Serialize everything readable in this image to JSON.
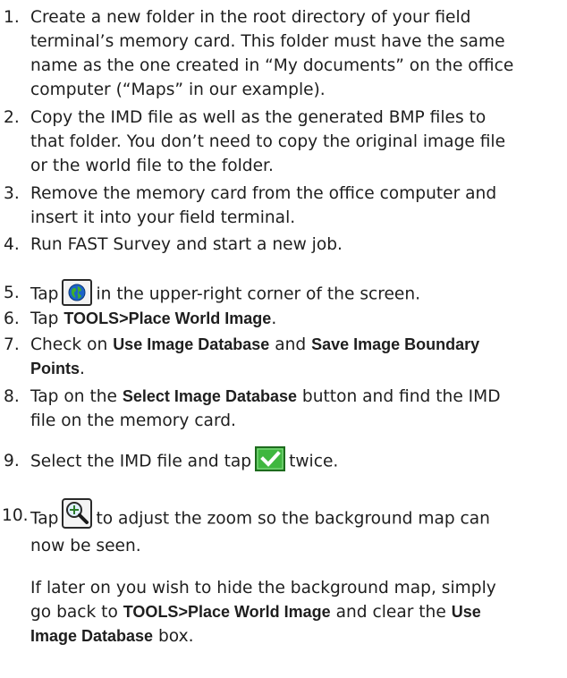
{
  "steps": [
    {
      "num": "1.",
      "lines": [
        "Create a new folder in the root directory of your field",
        "terminal’s memory card. This folder must have the same",
        "name as the one created in “My documents” on the office",
        "computer (“Maps” in our example)."
      ]
    },
    {
      "num": "2.",
      "lines": [
        "Copy the IMD file as well as the generated BMP files to",
        "that folder. You don’t need to copy the original image file",
        "or the world file to the folder."
      ]
    },
    {
      "num": "3.",
      "lines": [
        "Remove the memory card from the office computer and",
        "insert it into your field terminal."
      ]
    },
    {
      "num": "4.",
      "text": "Run FAST Survey and start a new job."
    },
    {
      "num": "5.",
      "pre": "Tap",
      "post": "in the upper-right corner of the screen."
    },
    {
      "num": "6.",
      "pre": "Tap ",
      "bold": "TOOLS>Place World Image",
      "post": "."
    },
    {
      "num": "7.",
      "pre": "Check on ",
      "bold1": "Use Image Database",
      "mid": " and ",
      "bold2": "Save Image Boundary",
      "bold2b": "Points",
      "post": "."
    },
    {
      "num": "8.",
      "pre": "Tap on the ",
      "bold": "Select Image Database",
      "post": " button and find the IMD",
      "line2": "file on the memory card."
    },
    {
      "num": "9.",
      "pre": "Select the IMD file and tap",
      "post": "twice."
    },
    {
      "num": "10.",
      "pre": "Tap",
      "post": "to adjust the zoom so the background map can",
      "line2": "now be seen."
    }
  ],
  "note": {
    "line1": "If later on you wish to hide the background map, simply",
    "pre2": "go back to ",
    "bold2": "TOOLS>Place World Image",
    "mid2": " and clear the ",
    "bold2b": "Use",
    "bold3": "Image Database",
    "post3": " box."
  },
  "icons": {
    "globe": "globe-icon",
    "check": "check-icon",
    "zoom": "zoom-icon"
  },
  "colors": {
    "check_green": "#3fb73f",
    "globe_blue": "#1b63c9"
  }
}
